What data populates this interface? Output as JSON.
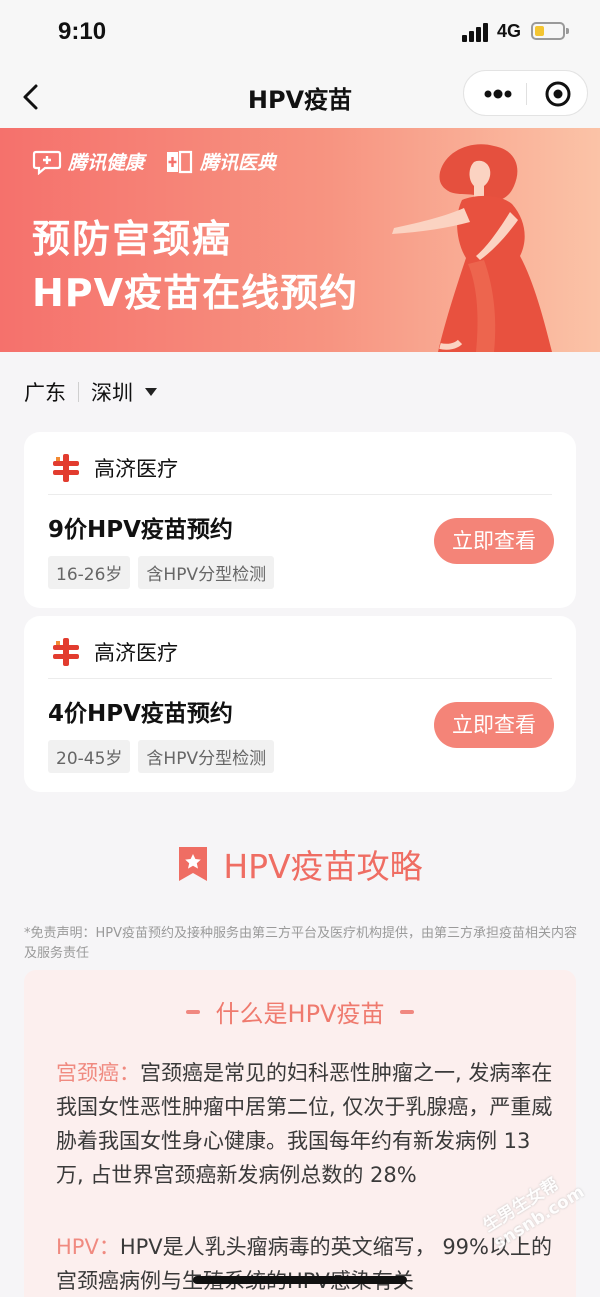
{
  "status_bar": {
    "time": "9:10",
    "network": "4G"
  },
  "nav": {
    "title": "HPV疫苗"
  },
  "banner": {
    "brand_health": "腾讯健康",
    "brand_dict": "腾讯医典",
    "headline_1": "预防宫颈癌",
    "headline_2": "HPV疫苗在线预约"
  },
  "location": {
    "province": "广东",
    "city": "深圳"
  },
  "cards": [
    {
      "provider": "高济医疗",
      "title": "9价HPV疫苗预约",
      "tags": [
        "16-26岁",
        "含HPV分型检测"
      ],
      "button": "立即查看"
    },
    {
      "provider": "高济医疗",
      "title": "4价HPV疫苗预约",
      "tags": [
        "20-45岁",
        "含HPV分型检测"
      ],
      "button": "立即查看"
    }
  ],
  "guide": {
    "title": "HPV疫苗攻略"
  },
  "disclaimer": "*免责声明：HPV疫苗预约及接种服务由第三方平台及医疗机构提供，由第三方承担疫苗相关内容及服务责任",
  "section": {
    "heading": "什么是HPV疫苗",
    "p1_label": "宫颈癌：",
    "p1_text": "宫颈癌是常见的妇科恶性肿瘤之一, 发病率在我国女性恶性肿瘤中居第二位, 仅次于乳腺癌，严重威胁着我国女性身心健康。我国每年约有新发病例 13 万, 占世界宫颈癌新发病例总数的 28%",
    "p2_label": "HPV：",
    "p2_text": "HPV是人乳头瘤病毒的英文缩写， 99%以上的宫颈癌病例与生殖系统的HPV感染有关"
  },
  "watermark": "生男生女帮 snsnb.com",
  "colors": {
    "accent": "#f48478",
    "guide_red": "#ef6d63",
    "banner_start": "#f5716c",
    "banner_end": "#fbc3a7"
  }
}
